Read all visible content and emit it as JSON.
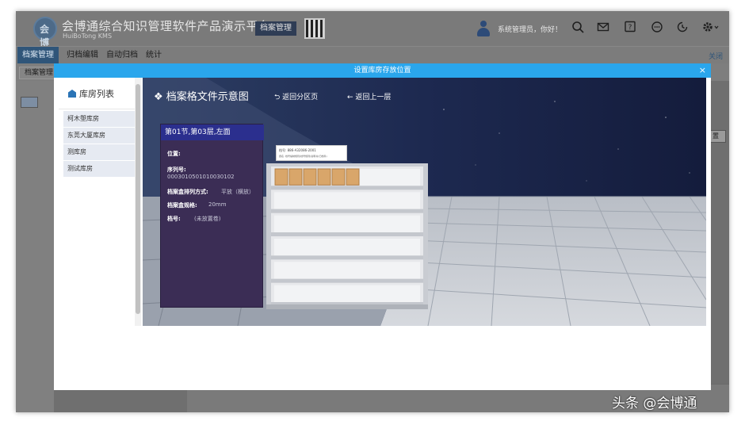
{
  "app": {
    "title": "会博通综合知识管理软件产品演示平台",
    "subtitle": "HuiBoTong KMS",
    "logo_text": "会博",
    "archive_button": "档案管理",
    "user_greeting": "系统管理员，你好！",
    "icons": [
      "search-icon",
      "mail-icon",
      "help-icon",
      "chat-icon",
      "clock-icon",
      "gear-icon"
    ]
  },
  "nav": {
    "items": [
      "档案管理",
      "归档编辑",
      "自动归档",
      "统计"
    ],
    "close_label": "关闭"
  },
  "subbar": {
    "tab": "档案管理"
  },
  "background": {
    "right_button": "置"
  },
  "modal": {
    "title": "设置库房存放位置",
    "close_icon": "×"
  },
  "sidebar": {
    "title": "库房列表",
    "items": [
      "柯木塱库房",
      "东莞大厦库房",
      "测库房",
      "测试库房"
    ]
  },
  "scene": {
    "title": "档案格文件示意图",
    "back_partition": "返回分区页",
    "back_up": "返回上一层",
    "info": {
      "header": "第01节,第03层,左面",
      "position_label": "位置:",
      "serial_label": "序列号:",
      "serial_value": "0003010501010030102",
      "arrange_label": "档案盒排列方式:",
      "arrange_value": "平放（横放）",
      "spec_label": "档案盒规格:",
      "spec_value": "20mm",
      "number_label": "档号:",
      "number_value": "(未放置卷)"
    },
    "tooltip": {
      "line1": "档号: 886-A32086-2001",
      "line2": "题名: 档号编制规则(档号规则)说明书(归档科)"
    },
    "shelf": {
      "rows": 6,
      "boxes_on_top_row": 6
    }
  },
  "watermark": "头条 @会博通",
  "colors": {
    "modal_header": "#2aa6ec",
    "scene_sky": "#1f2a49",
    "info_panel": "#3b2d55",
    "info_header": "#2b2f8e",
    "sidebar_item": "#e6eaf2",
    "box": "#d9a66a"
  }
}
